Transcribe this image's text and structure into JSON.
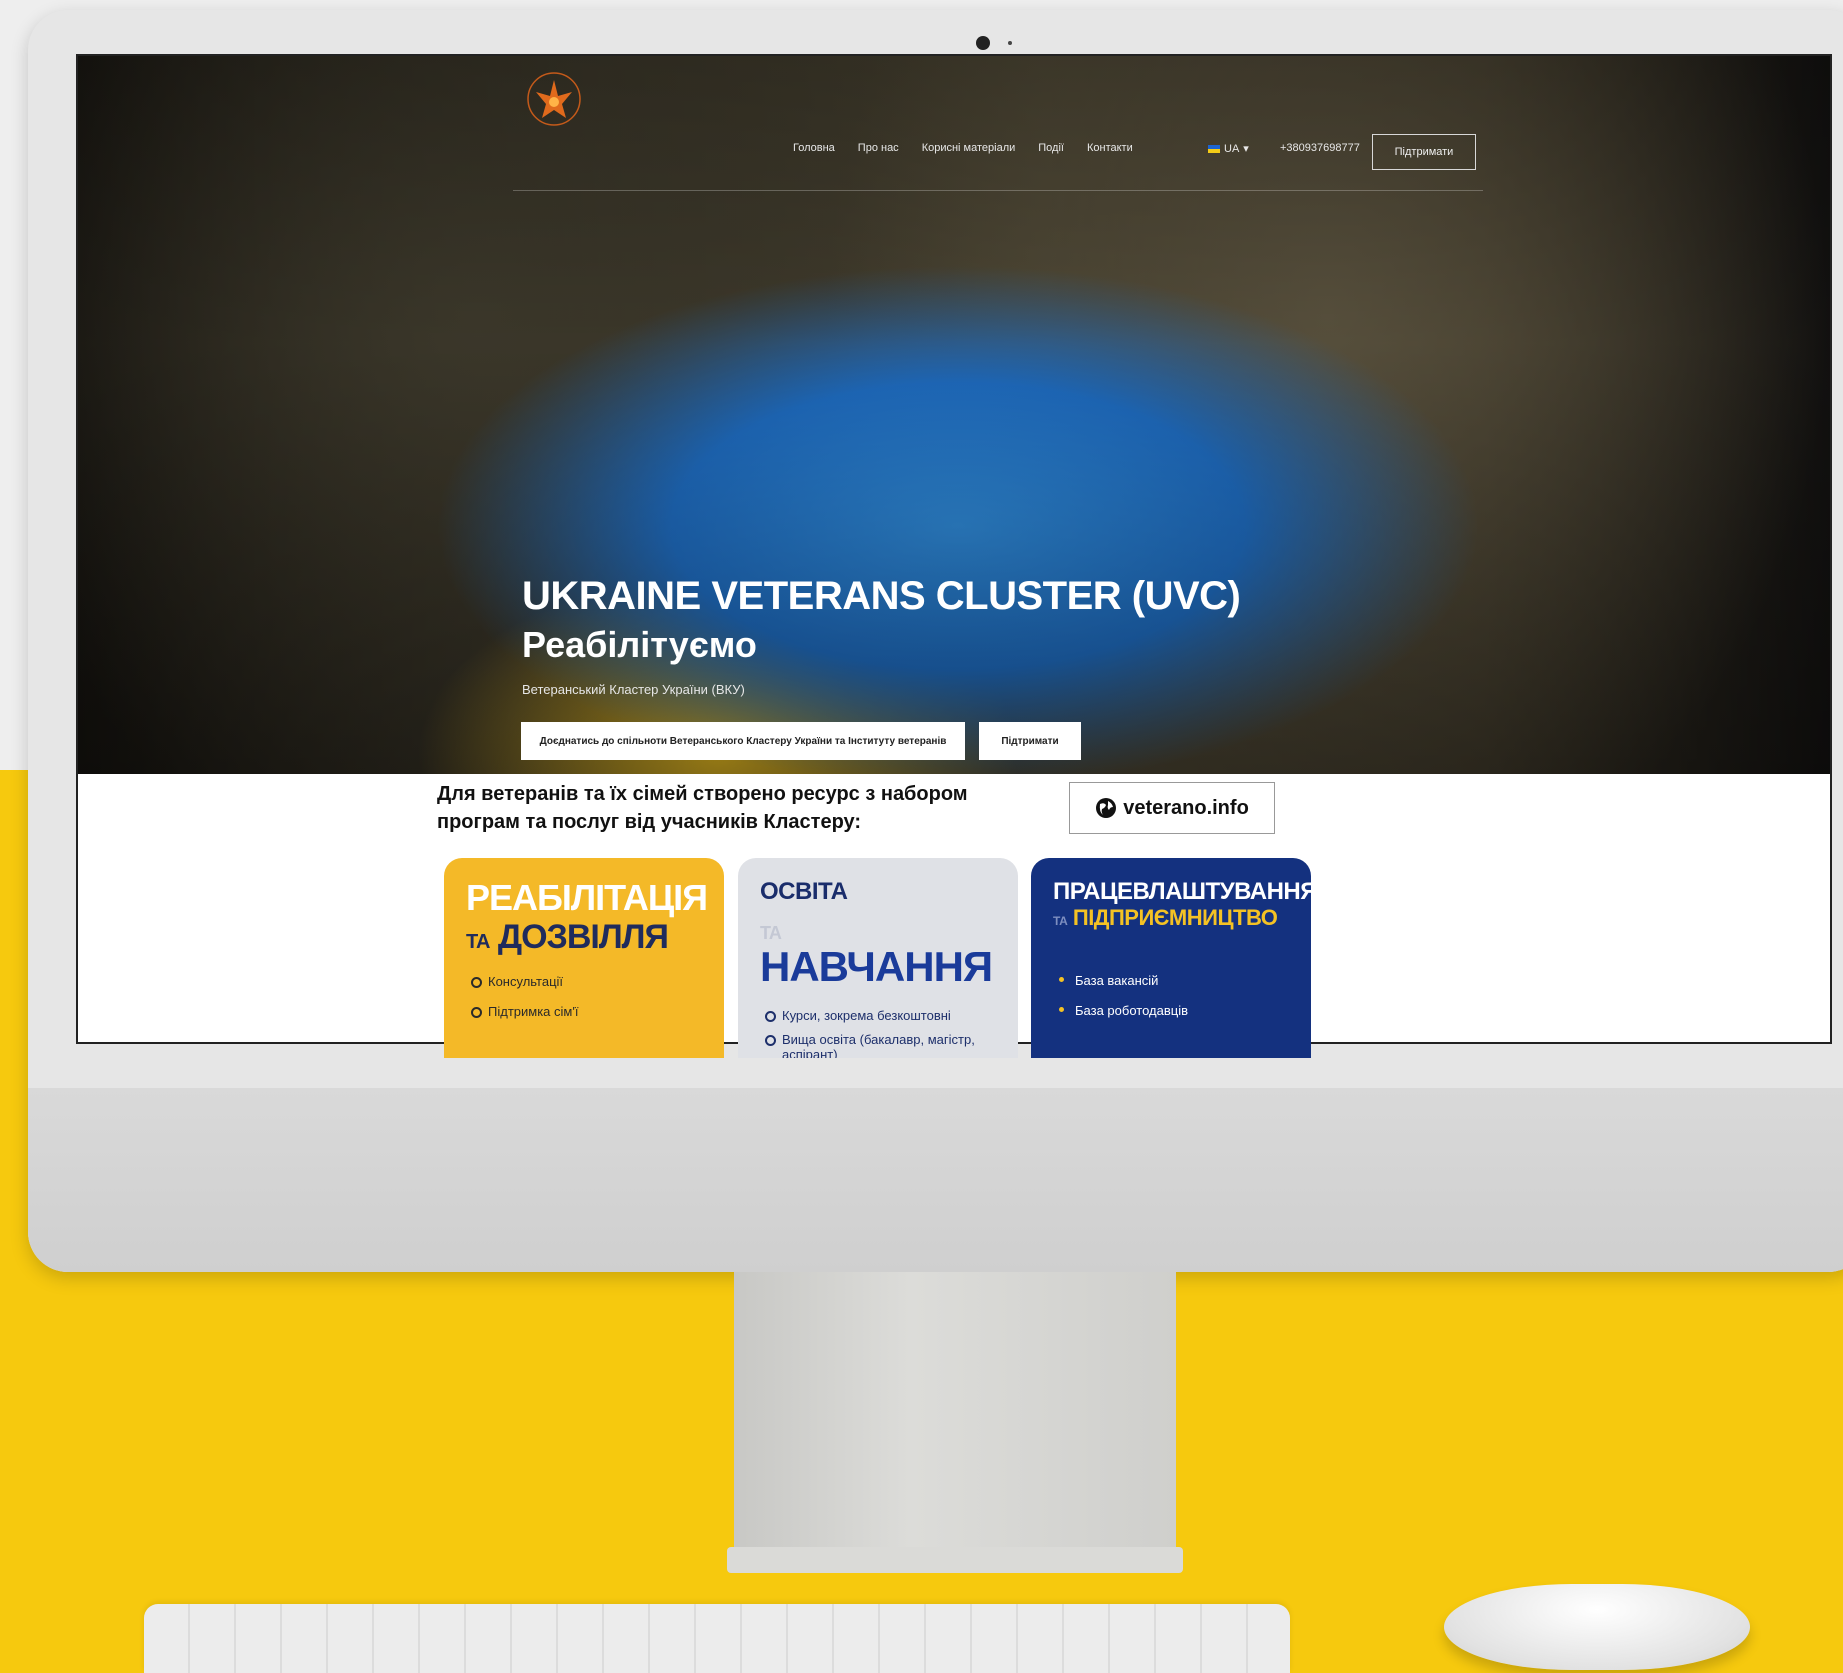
{
  "nav": {
    "items": [
      "Головна",
      "Про нас",
      "Корисні матеріали",
      "Події",
      "Контакти"
    ],
    "language": "UA",
    "phone": "+380937698777",
    "support_label": "Підтримати"
  },
  "hero": {
    "title": "UKRAINE VETERANS CLUSTER (UVC)",
    "subtitle": "Реабілітуємо",
    "tagline": "Ветеранський Кластер України (ВКУ)",
    "join_button": "Доєднатись до спільноти Ветеранського Кластеру України та Інституту ветеранів",
    "support_button": "Підтримати"
  },
  "intro": {
    "text": "Для ветеранів та їх сімей створено ресурс з набором програм та послуг від учасників Кластеру:",
    "site_button": "veterano.info"
  },
  "cards": [
    {
      "title_top": "РЕАБІЛІТАЦІЯ",
      "title_connector": "ТА",
      "title_bottom": "ДОЗВІЛЛЯ",
      "items": [
        "Консультації",
        "Підтримка сім'ї"
      ]
    },
    {
      "title_top": "ОСВІТА",
      "title_connector": "ТА",
      "title_bottom": "НАВЧАННЯ",
      "items": [
        "Курси, зокрема безкоштовні",
        "Вища освіта (бакалавр, магістр, аспірант)"
      ]
    },
    {
      "title_top": "ПРАЦЕВЛАШТУВАННЯ",
      "title_connector": "ТА",
      "title_bottom": "ПІДПРИЄМНИЦТВО",
      "items": [
        "База вакансій",
        "База роботодавців"
      ]
    }
  ],
  "colors": {
    "background_yellow": "#f6c90e",
    "card_yellow": "#f4b928",
    "card_grey": "#dfe1e6",
    "card_blue": "#14317f",
    "flag_blue": "#1c64d1",
    "flag_yellow": "#f4cc17"
  },
  "icons": {
    "logo": "eagle-emblem",
    "site_button_icon": "globe-icon"
  }
}
